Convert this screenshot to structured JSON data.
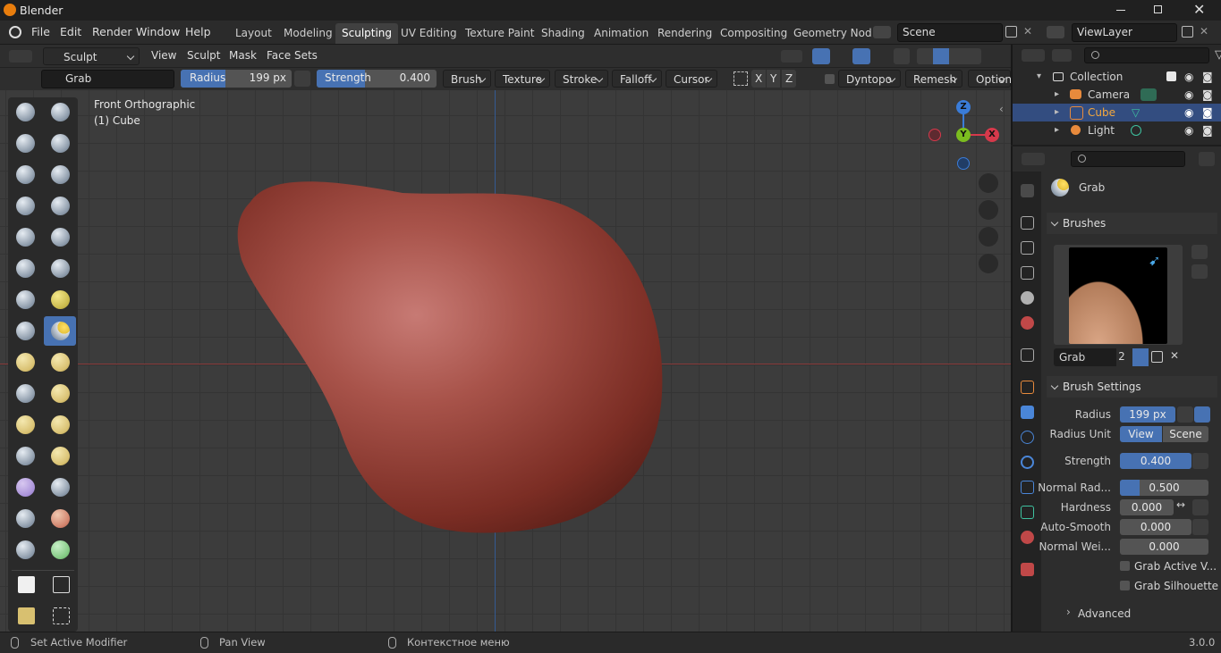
{
  "app": {
    "title": "Blender",
    "version": "3.0.0"
  },
  "menu": [
    "File",
    "Edit",
    "Render",
    "Window",
    "Help"
  ],
  "workspaces": [
    "Layout",
    "Modeling",
    "Sculpting",
    "UV Editing",
    "Texture Paint",
    "Shading",
    "Animation",
    "Rendering",
    "Compositing",
    "Geometry Nod"
  ],
  "active_workspace": "Sculpting",
  "scene": "Scene",
  "view_layer": "ViewLayer",
  "header": {
    "mode": "Sculpt Mode",
    "menus": [
      "View",
      "Sculpt",
      "Mask",
      "Face Sets"
    ]
  },
  "tool_header": {
    "brush": "Grab",
    "radius_label": "Radius",
    "radius_value": "199 px",
    "strength_label": "Strength",
    "strength_value": "0.400",
    "dropdowns": [
      "Brush",
      "Texture",
      "Stroke",
      "Falloff",
      "Cursor"
    ],
    "axes": [
      "X",
      "Y",
      "Z"
    ],
    "dyntopo": "Dyntopo",
    "remesh": "Remesh",
    "options": "Options"
  },
  "viewport": {
    "view_name": "Front Orthographic",
    "object_info": "(1) Cube",
    "gizmo": {
      "z": "Z",
      "y": "Y",
      "x": "X"
    }
  },
  "outliner": {
    "items": [
      "Collection",
      "Camera",
      "Cube",
      "Light"
    ],
    "selected": "Cube"
  },
  "properties": {
    "active_brush": "Grab",
    "brushes_panel": "Brushes",
    "brush_name": "Grab",
    "brush_users": "2",
    "settings_panel": "Brush Settings",
    "radius_label": "Radius",
    "radius": "199 px",
    "radius_unit_label": "Radius Unit",
    "unit_view": "View",
    "unit_scene": "Scene",
    "strength_label": "Strength",
    "strength": "0.400",
    "normal_radius_label": "Normal Rad...",
    "normal_radius": "0.500",
    "normal_radius_fill": 0.1,
    "hardness_label": "Hardness",
    "hardness": "0.000",
    "auto_smooth_label": "Auto-Smooth",
    "auto_smooth": "0.000",
    "normal_weight_label": "Normal Wei...",
    "normal_weight": "0.000",
    "grab_active_label": "Grab Active V...",
    "grab_silhouette_label": "Grab Silhouette",
    "advanced": "Advanced"
  },
  "status": {
    "left": "Set Active Modifier",
    "middle": "Pan View",
    "right": "Контекстное меню"
  },
  "colors": {
    "accent": "#4772b3",
    "selected_row": "#334d80",
    "object": "#8a3b30",
    "axis_x": "#d6394b",
    "axis_y": "#7bbd1f",
    "axis_z": "#3a7cd8"
  }
}
